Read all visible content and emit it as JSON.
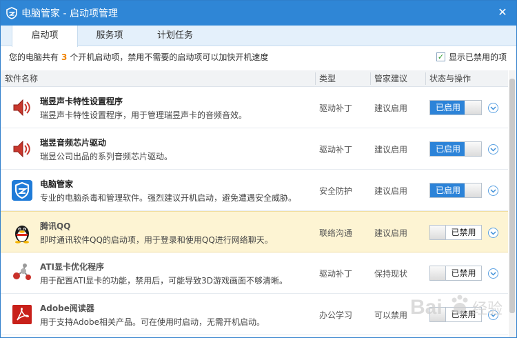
{
  "window": {
    "title": "电脑管家 - 启动项管理",
    "close_glyph": "✕"
  },
  "tabs": [
    {
      "label": "启动项",
      "active": true
    },
    {
      "label": "服务项",
      "active": false
    },
    {
      "label": "计划任务",
      "active": false
    }
  ],
  "info": {
    "prefix": "您的电脑共有",
    "count": "3",
    "suffix": "个开机启动项，禁用不需要的启动项可以加快开机速度",
    "show_disabled_label": "显示已禁用的项",
    "show_disabled_checked": true
  },
  "table": {
    "headers": [
      "软件名称",
      "类型",
      "管家建议",
      "状态与操作"
    ],
    "rows": [
      {
        "icon": "speaker-icon",
        "title": "瑞昱声卡特性设置程序",
        "desc": "瑞昱声卡特性设置程序，用于管理瑞昱声卡的音频音效。",
        "type": "驱动补丁",
        "advice": "建议启用",
        "status": "已启用",
        "enabled": true,
        "highlight": false
      },
      {
        "icon": "speaker-icon",
        "title": "瑞昱音频芯片驱动",
        "desc": "瑞昱公司出品的系列音频芯片驱动。",
        "type": "驱动补丁",
        "advice": "建议启用",
        "status": "已启用",
        "enabled": true,
        "highlight": false
      },
      {
        "icon": "shield-icon",
        "title": "电脑管家",
        "desc": "专业的电脑杀毒和管理软件。强烈建议开机启动，避免遭遇安全威胁。",
        "type": "安全防护",
        "advice": "建议启用",
        "status": "已启用",
        "enabled": true,
        "highlight": false
      },
      {
        "icon": "penguin-icon",
        "title": "腾讯QQ",
        "desc": "即时通讯软件QQ的启动项，用于登录和使用QQ进行网络聊天。",
        "type": "联络沟通",
        "advice": "建议启用",
        "status": "已禁用",
        "enabled": false,
        "highlight": true
      },
      {
        "icon": "molecule-icon",
        "title": "ATI显卡优化程序",
        "desc": "用于配置ATI显卡的功能，禁用后，可能导致3D游戏画面不够清晰。",
        "type": "驱动补丁",
        "advice": "保持现状",
        "status": "已禁用",
        "enabled": false,
        "highlight": false
      },
      {
        "icon": "acrobat-icon",
        "title": "Adobe阅读器",
        "desc": "用于支持Adobe相关产品。可在使用时启动，无需开机启动。",
        "type": "办公学习",
        "advice": "可以禁用",
        "status": "已禁用",
        "enabled": false,
        "highlight": false
      }
    ]
  },
  "watermark": {
    "text": "Bai百经验"
  },
  "colors": {
    "titlebar": "#2f86d6",
    "accent_blue": "#2c83d8",
    "count_orange": "#f08300",
    "highlight_row": "#fdf4d3"
  }
}
